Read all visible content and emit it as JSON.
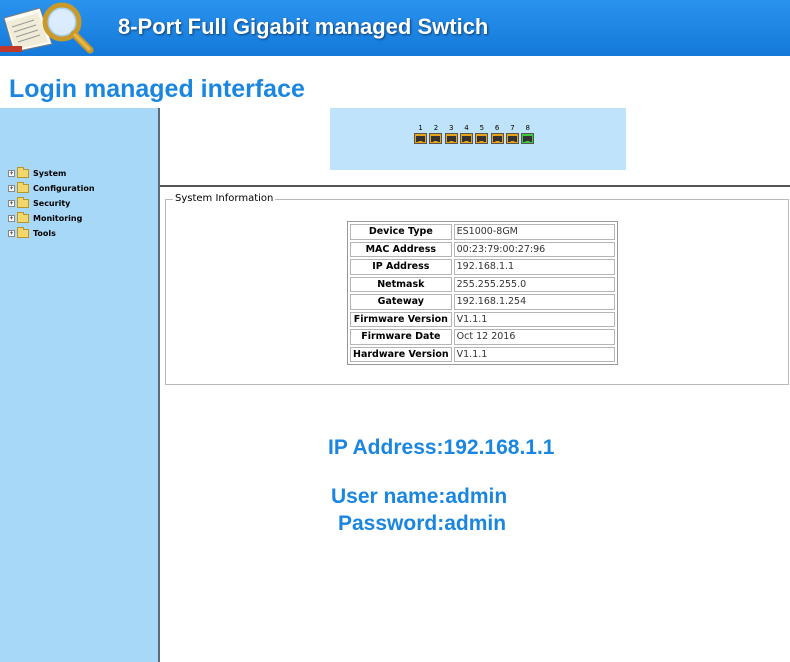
{
  "header": {
    "title": "8-Port Full Gigabit managed Swtich",
    "background": "#1a82e2"
  },
  "page": {
    "heading": "Login managed interface",
    "accent": "#1a86e0"
  },
  "sidebar": {
    "background": "#a7d8f8",
    "items": [
      {
        "label": "System",
        "icon": "folder-icon"
      },
      {
        "label": "Configuration",
        "icon": "folder-icon"
      },
      {
        "label": "Security",
        "icon": "folder-icon"
      },
      {
        "label": "Monitoring",
        "icon": "folder-icon"
      },
      {
        "label": "Tools",
        "icon": "folder-icon"
      }
    ]
  },
  "ports": {
    "items": [
      {
        "label": "1",
        "status": "down",
        "color": "#e8a317"
      },
      {
        "label": "2",
        "status": "down",
        "color": "#e8a317"
      },
      {
        "label": "3",
        "status": "down",
        "color": "#e8a317"
      },
      {
        "label": "4",
        "status": "down",
        "color": "#e8a317"
      },
      {
        "label": "5",
        "status": "down",
        "color": "#e8a317"
      },
      {
        "label": "6",
        "status": "down",
        "color": "#e8a317"
      },
      {
        "label": "7",
        "status": "down",
        "color": "#e8a317"
      },
      {
        "label": "8",
        "status": "up",
        "color": "#3ecb3e"
      }
    ]
  },
  "system_info": {
    "legend": "System Information",
    "rows": [
      {
        "label": "Device Type",
        "value": "ES1000-8GM"
      },
      {
        "label": "MAC Address",
        "value": "00:23:79:00:27:96"
      },
      {
        "label": "IP Address",
        "value": "192.168.1.1"
      },
      {
        "label": "Netmask",
        "value": "255.255.255.0"
      },
      {
        "label": "Gateway",
        "value": "192.168.1.254"
      },
      {
        "label": "Firmware Version",
        "value": "V1.1.1"
      },
      {
        "label": "Firmware Date",
        "value": "Oct 12 2016"
      },
      {
        "label": "Hardware Version",
        "value": "V1.1.1"
      }
    ]
  },
  "notes": {
    "ip": "IP Address:192.168.1.1",
    "user": "User name:admin",
    "password": "Password:admin"
  }
}
